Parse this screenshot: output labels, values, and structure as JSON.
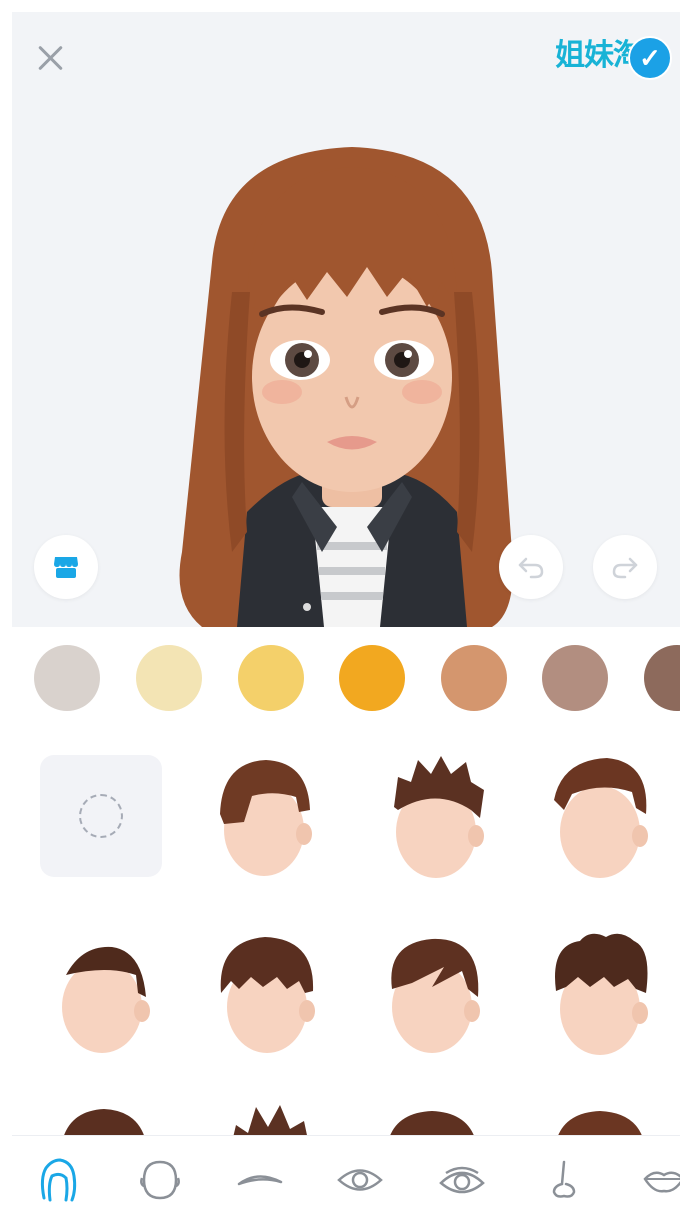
{
  "header": {
    "close_icon": "close-icon",
    "watermark_text": "姐妹淘"
  },
  "preview": {
    "store_icon": "store-icon",
    "undo_icon": "undo-icon",
    "redo_icon": "redo-icon",
    "hair_color": "#a0562f",
    "skin_color": "#f2c8ae"
  },
  "hair_colors": [
    "#d9d2cd",
    "#f3e4b4",
    "#f4d06a",
    "#f2a820",
    "#d4966e",
    "#b28e80",
    "#8d6a5c"
  ],
  "selected_color_index": 3,
  "hairstyles": [
    {
      "name": "none",
      "selected": true
    },
    {
      "name": "side-part-short"
    },
    {
      "name": "spiky-fade"
    },
    {
      "name": "swept-quiff"
    },
    {
      "name": "buzz-side"
    },
    {
      "name": "fringe-tousled"
    },
    {
      "name": "angled-fringe"
    },
    {
      "name": "curly-top"
    }
  ],
  "tabs": [
    {
      "name": "hair",
      "icon": "hair-icon",
      "active": true
    },
    {
      "name": "face",
      "icon": "face-shape-icon"
    },
    {
      "name": "eyebrows",
      "icon": "eyebrow-icon"
    },
    {
      "name": "eyes",
      "icon": "eye-icon"
    },
    {
      "name": "eyes-color",
      "icon": "eye-detail-icon"
    },
    {
      "name": "nose",
      "icon": "nose-icon"
    },
    {
      "name": "lips",
      "icon": "lips-icon"
    }
  ]
}
